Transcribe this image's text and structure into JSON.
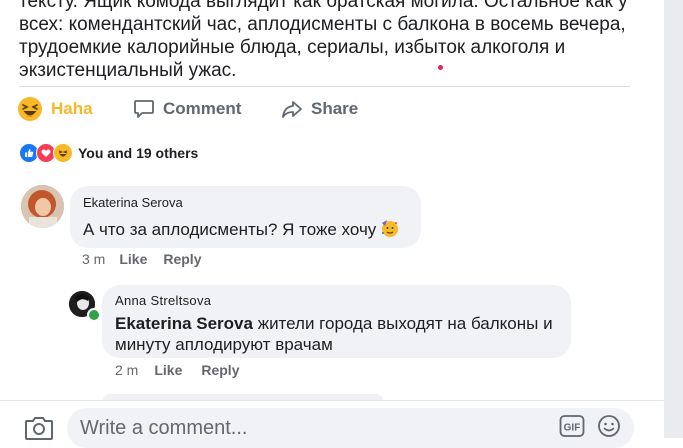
{
  "post": {
    "text_lines": [
      "тексту. Ящик комода выглядит как братская могила. Остальное как у",
      "всех: комендантский час, аплодисменты с балкона в восемь вечера,",
      "трудоемкие калорийные блюда, сериалы, избыток алкоголя и",
      "экзистенциальный ужас."
    ]
  },
  "actions": {
    "haha_label": "Haha",
    "comment_label": "Comment",
    "share_label": "Share"
  },
  "reactions": {
    "summary": "You and 19 others",
    "types": [
      "like-icon",
      "love-icon",
      "haha-icon"
    ]
  },
  "comments": [
    {
      "author": "Ekaterina Serova",
      "text": "А что за аплодисменты? Я тоже хочу",
      "emoji": "partying-face-icon",
      "time": "3 m",
      "like_label": "Like",
      "reply_label": "Reply"
    }
  ],
  "reply": {
    "author": "Anna  Streltsova",
    "mention": "Ekaterina Serova",
    "text": " жители города выходят на балконы и минуту аплодируют врачам",
    "time": "2 m",
    "like_label": "Like",
    "reply_label": "Reply",
    "online": true
  },
  "composer": {
    "placeholder": "Write a comment...",
    "icons": [
      "camera-icon",
      "gif-icon",
      "smile-icon"
    ]
  },
  "colors": {
    "haha": "#f7b928",
    "secondary_text": "#65676b",
    "bubble": "#f0f2f5",
    "like": "#1877f2",
    "love": "#f33e58",
    "online": "#31a24c"
  }
}
